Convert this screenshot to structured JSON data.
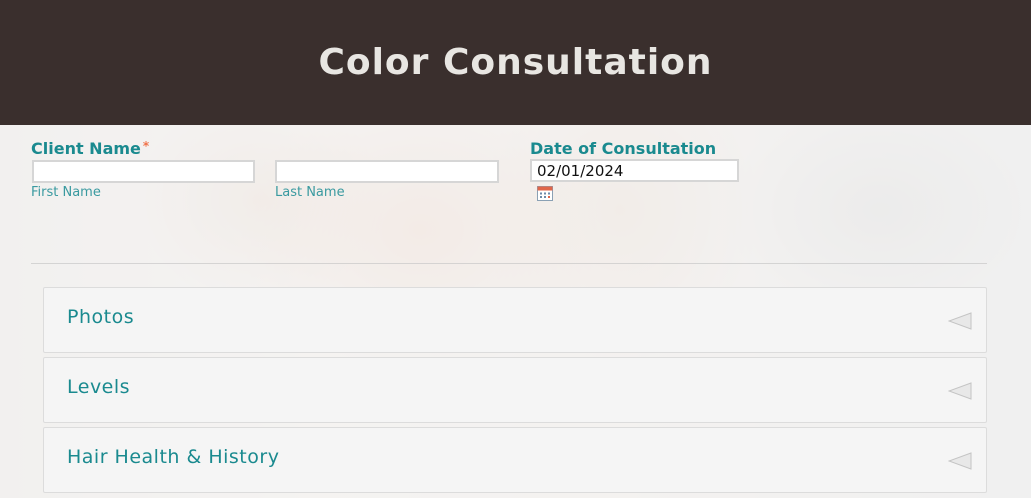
{
  "header": {
    "title": "Color Consultation"
  },
  "form": {
    "client_name": {
      "label": "Client Name",
      "required_mark": "*",
      "first_name": {
        "value": "",
        "sublabel": "First Name"
      },
      "last_name": {
        "value": "",
        "sublabel": "Last Name"
      }
    },
    "date_of_consultation": {
      "label": "Date of Consultation",
      "value": "02/01/2024"
    }
  },
  "sections": [
    {
      "title": "Photos",
      "icon": "collapse-triangle-icon"
    },
    {
      "title": "Levels",
      "icon": "collapse-triangle-icon"
    },
    {
      "title": "Hair Health & History",
      "icon": "collapse-triangle-icon"
    }
  ],
  "colors": {
    "header_bg": "#3a2f2d",
    "header_text": "#e8e6e2",
    "accent_teal": "#1a8a8f",
    "required_star": "#f0734b"
  }
}
